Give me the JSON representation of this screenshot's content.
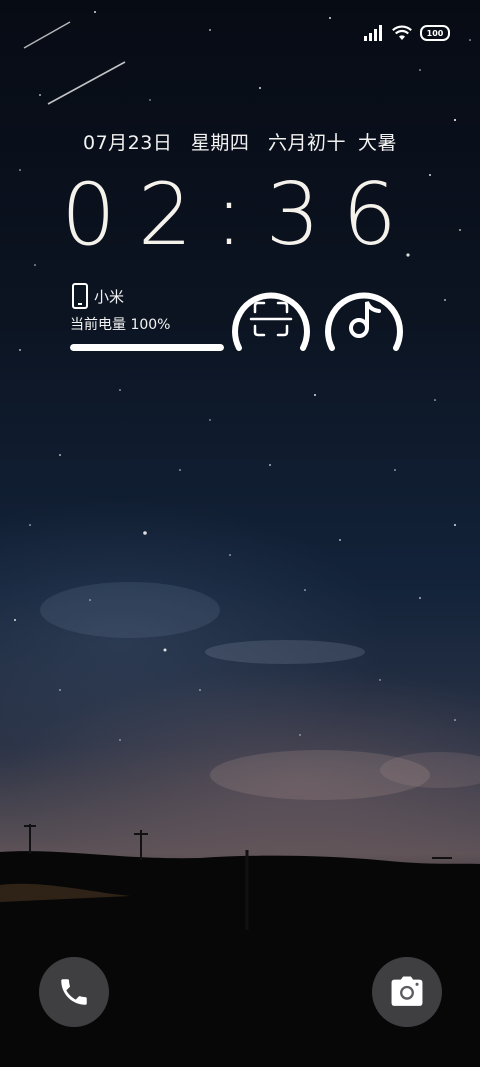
{
  "status_bar": {
    "signal_icon": "signal-bars-icon",
    "wifi_icon": "wifi-icon",
    "battery_level": "100"
  },
  "lock_screen": {
    "date": "07月23日",
    "weekday": "星期四",
    "lunar_date": "六月初十",
    "solar_term": "大暑",
    "time": "02:36"
  },
  "battery_widget": {
    "device_icon": "phone-device-icon",
    "device_name": "小米",
    "battery_label": "当前电量 100%",
    "battery_fraction": 1.0
  },
  "shortcuts": [
    {
      "name": "scan",
      "icon": "scan-icon"
    },
    {
      "name": "douyin",
      "icon": "tiktok-icon"
    }
  ],
  "bottom_actions": {
    "left_icon": "phone-icon",
    "right_icon": "camera-icon"
  },
  "colors": {
    "text": "#ffffff",
    "button_bg": "#6e6e73"
  }
}
